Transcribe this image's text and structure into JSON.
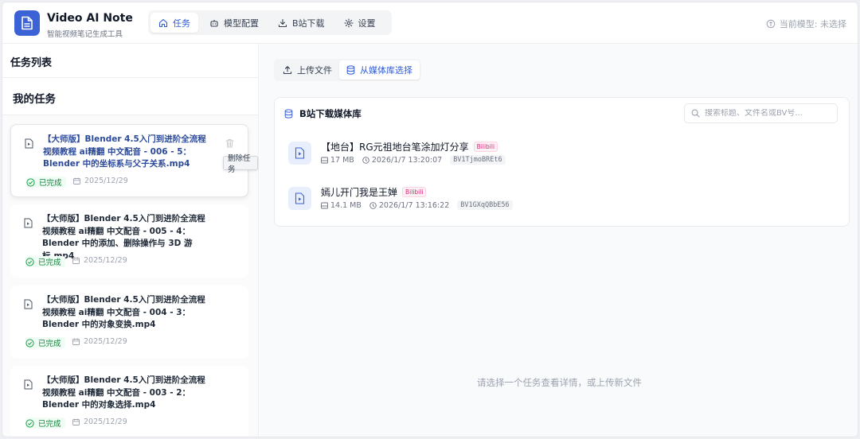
{
  "app": {
    "title": "Video AI Note",
    "subtitle": "智能视频笔记生成工具"
  },
  "nav": {
    "items": [
      {
        "label": "任务",
        "icon": "home-icon",
        "active": true
      },
      {
        "label": "模型配置",
        "icon": "robot-icon",
        "active": false
      },
      {
        "label": "B站下载",
        "icon": "download-icon",
        "active": false
      },
      {
        "label": "设置",
        "icon": "gear-icon",
        "active": false
      }
    ]
  },
  "header": {
    "model_status": "当前模型: 未选择"
  },
  "sidebar": {
    "title": "任务列表",
    "section_title": "我的任务",
    "delete_tooltip": "删除任务",
    "tasks": [
      {
        "title": "【大师版】Blender 4.5入门到进阶全流程视频教程 ai精翻 中文配音 - 006 - 5：Blender 中的坐标系与父子关系.mp4",
        "status": "已完成",
        "date": "2025/12/29",
        "selected": true
      },
      {
        "title": "【大师版】Blender 4.5入门到进阶全流程视频教程 ai精翻 中文配音 - 005 - 4：Blender 中的添加、删除操作与 3D 游标.mp4",
        "status": "已完成",
        "date": "2025/12/29",
        "selected": false
      },
      {
        "title": "【大师版】Blender 4.5入门到进阶全流程视频教程 ai精翻 中文配音 - 004 - 3：Blender 中的对象变换.mp4",
        "status": "已完成",
        "date": "2025/12/29",
        "selected": false
      },
      {
        "title": "【大师版】Blender 4.5入门到进阶全流程视频教程 ai精翻 中文配音 - 003 - 2：Blender 中的对象选择.mp4",
        "status": "已完成",
        "date": "2025/12/29",
        "selected": false
      }
    ]
  },
  "main": {
    "tabs": [
      {
        "label": "上传文件",
        "icon": "upload-icon",
        "active": false
      },
      {
        "label": "从媒体库选择",
        "icon": "database-icon",
        "active": true
      }
    ],
    "library": {
      "title": "B站下载媒体库",
      "search_placeholder": "搜索标题、文件名或BV号...",
      "items": [
        {
          "title": "【地台】RG元祖地台笔涂加灯分享",
          "source": "Bilibili",
          "size": "17 MB",
          "datetime": "2026/1/7 13:20:07",
          "bv": "BV1TjmoBREt6"
        },
        {
          "title": "嫣儿开门我是王婵",
          "source": "Bilibili",
          "size": "14.1 MB",
          "datetime": "2026/1/7 13:16:22",
          "bv": "BV1GXqQBbE56"
        }
      ]
    },
    "empty_hint": "请选择一个任务查看详情，或上传新文件"
  },
  "colors": {
    "accent": "#3b63d6",
    "success": "#15803d",
    "bilibili": "#db2777"
  }
}
